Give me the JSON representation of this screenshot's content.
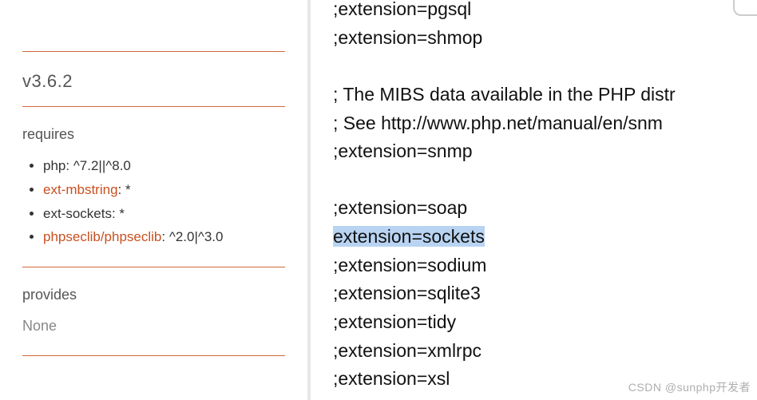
{
  "sidebar": {
    "version": "v3.6.2",
    "requires_head": "requires",
    "requires": [
      {
        "label": "php",
        "constraint": ": ^7.2||^8.0",
        "link": false
      },
      {
        "label": "ext-mbstring",
        "constraint": ": *",
        "link": true
      },
      {
        "label": "ext-sockets",
        "constraint": ": *",
        "link": false
      },
      {
        "label": "phpseclib/phpseclib",
        "constraint": ": ^2.0|^3.0",
        "link": true
      }
    ],
    "provides_head": "provides",
    "provides_value": "None"
  },
  "editor": {
    "lines": [
      ";extension=pgsql",
      ";extension=shmop",
      "",
      "; The MIBS data available in the PHP distr",
      "; See http://www.php.net/manual/en/snm",
      ";extension=snmp",
      "",
      ";extension=soap",
      "extension=sockets",
      ";extension=sodium",
      ";extension=sqlite3",
      ";extension=tidy",
      ";extension=xmlrpc",
      ";extension=xsl"
    ],
    "highlighted_index": 8
  },
  "watermark": "CSDN @sunphp开发者"
}
